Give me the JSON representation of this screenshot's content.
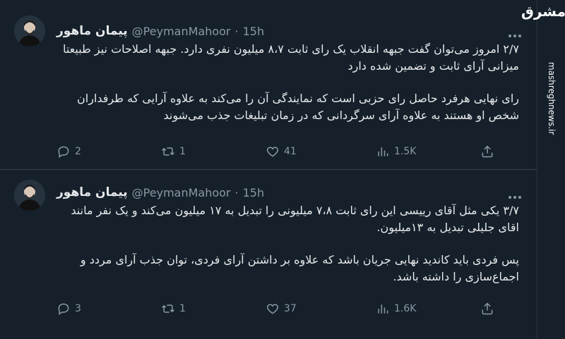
{
  "colors": {
    "background": "#15202b",
    "text": "#e7e9ea",
    "muted": "#8b98a5",
    "divider": "#38444d"
  },
  "tweets": [
    {
      "name": "پیمان ماهور",
      "handle": "@PeymanMahoor",
      "dot": "·",
      "time": "15h",
      "paragraphs": [
        "۲/۷ امروز می‌توان گفت جبهه انقلاب یک رای ثابت ۸،۷ میلیون نفری دارد. جبهه اصلاحات نیز طبیعتا میزانی آرای ثابت و تضمین شده دارد",
        "رای نهایی هرفرد حاصل رای حزبی است که نمایندگی آن را می‌کند به علاوه آرایی که طرفداران شخص او هستند به علاوه آرای سرگردانی که در زمان تبلیغات جذب می‌شوند"
      ],
      "stats": {
        "replies": "2",
        "retweets": "1",
        "likes": "41",
        "views": "1.5K"
      }
    },
    {
      "name": "پیمان ماهور",
      "handle": "@PeymanMahoor",
      "dot": "·",
      "time": "15h",
      "paragraphs": [
        "۳/۷ یکی مثل آقای رییسی این رای ثابت ۷،۸ میلیونی را تبدیل به ۱۷ میلیون می‌کند و یک نفر مانند اقای جلیلی تبدیل به ۱۳میلیون.",
        "پس فردی باید کاندید نهایی جریان باشد که علاوه بر داشتن آرای فردی، توان جذب آرای مردد و اجماع‌سازی را داشته باشد."
      ],
      "stats": {
        "replies": "3",
        "retweets": "1",
        "likes": "37",
        "views": "1.6K"
      }
    }
  ],
  "watermark": {
    "logo": "مشرق",
    "url": "mashreghnews.ir"
  }
}
